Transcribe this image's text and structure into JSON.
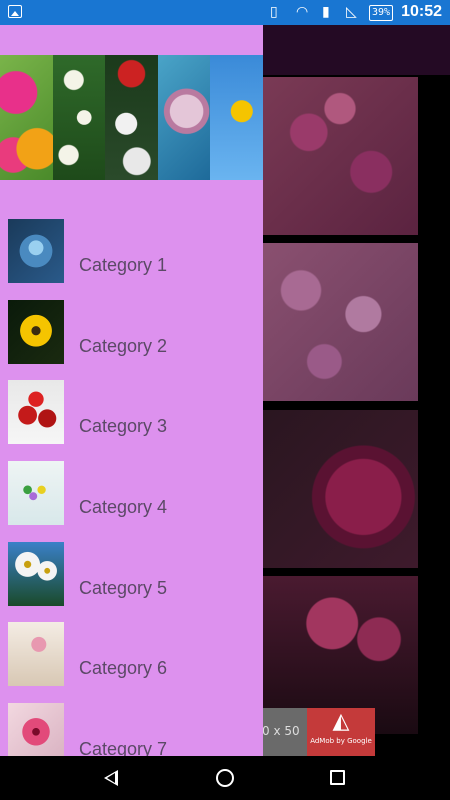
{
  "status_bar": {
    "battery": "39%",
    "time": "10:52",
    "icons": [
      "image-notification-icon",
      "vibrate-icon",
      "wifi-icon",
      "sim-icon",
      "no-signal-icon",
      "battery-icon"
    ]
  },
  "drawer": {
    "header_images": [
      "gerbera-flowers",
      "white-flowers",
      "rose-bouquet",
      "blue-rose",
      "sunflower-sky"
    ],
    "categories": [
      {
        "label": "Category 1",
        "thumb": "blue-petals"
      },
      {
        "label": "Category 2",
        "thumb": "yellow-daisy"
      },
      {
        "label": "Category 3",
        "thumb": "red-roses"
      },
      {
        "label": "Category 4",
        "thumb": "spring-flowers"
      },
      {
        "label": "Category 5",
        "thumb": "white-daisies"
      },
      {
        "label": "Category 6",
        "thumb": "pink-cosmos"
      },
      {
        "label": "Category 7",
        "thumb": "red-carnation"
      }
    ]
  },
  "ad": {
    "text": "0 x 50",
    "logo": "AdMob by Google"
  },
  "colors": {
    "status_bar": "#1976d2",
    "drawer_bg": "#dd91ee",
    "label_text": "#5b4966",
    "toolbar": "#240a24"
  }
}
